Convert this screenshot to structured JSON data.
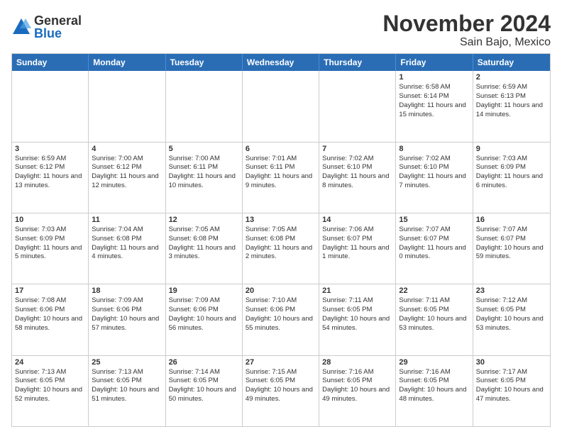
{
  "header": {
    "logo": {
      "general": "General",
      "blue": "Blue"
    },
    "title": "November 2024",
    "subtitle": "Sain Bajo, Mexico"
  },
  "calendar": {
    "days_of_week": [
      "Sunday",
      "Monday",
      "Tuesday",
      "Wednesday",
      "Thursday",
      "Friday",
      "Saturday"
    ],
    "weeks": [
      [
        {
          "day": "",
          "empty": true
        },
        {
          "day": "",
          "empty": true
        },
        {
          "day": "",
          "empty": true
        },
        {
          "day": "",
          "empty": true
        },
        {
          "day": "",
          "empty": true
        },
        {
          "day": "1",
          "sunrise": "Sunrise: 6:58 AM",
          "sunset": "Sunset: 6:14 PM",
          "daylight": "Daylight: 11 hours and 15 minutes."
        },
        {
          "day": "2",
          "sunrise": "Sunrise: 6:59 AM",
          "sunset": "Sunset: 6:13 PM",
          "daylight": "Daylight: 11 hours and 14 minutes."
        }
      ],
      [
        {
          "day": "3",
          "sunrise": "Sunrise: 6:59 AM",
          "sunset": "Sunset: 6:12 PM",
          "daylight": "Daylight: 11 hours and 13 minutes."
        },
        {
          "day": "4",
          "sunrise": "Sunrise: 7:00 AM",
          "sunset": "Sunset: 6:12 PM",
          "daylight": "Daylight: 11 hours and 12 minutes."
        },
        {
          "day": "5",
          "sunrise": "Sunrise: 7:00 AM",
          "sunset": "Sunset: 6:11 PM",
          "daylight": "Daylight: 11 hours and 10 minutes."
        },
        {
          "day": "6",
          "sunrise": "Sunrise: 7:01 AM",
          "sunset": "Sunset: 6:11 PM",
          "daylight": "Daylight: 11 hours and 9 minutes."
        },
        {
          "day": "7",
          "sunrise": "Sunrise: 7:02 AM",
          "sunset": "Sunset: 6:10 PM",
          "daylight": "Daylight: 11 hours and 8 minutes."
        },
        {
          "day": "8",
          "sunrise": "Sunrise: 7:02 AM",
          "sunset": "Sunset: 6:10 PM",
          "daylight": "Daylight: 11 hours and 7 minutes."
        },
        {
          "day": "9",
          "sunrise": "Sunrise: 7:03 AM",
          "sunset": "Sunset: 6:09 PM",
          "daylight": "Daylight: 11 hours and 6 minutes."
        }
      ],
      [
        {
          "day": "10",
          "sunrise": "Sunrise: 7:03 AM",
          "sunset": "Sunset: 6:09 PM",
          "daylight": "Daylight: 11 hours and 5 minutes."
        },
        {
          "day": "11",
          "sunrise": "Sunrise: 7:04 AM",
          "sunset": "Sunset: 6:08 PM",
          "daylight": "Daylight: 11 hours and 4 minutes."
        },
        {
          "day": "12",
          "sunrise": "Sunrise: 7:05 AM",
          "sunset": "Sunset: 6:08 PM",
          "daylight": "Daylight: 11 hours and 3 minutes."
        },
        {
          "day": "13",
          "sunrise": "Sunrise: 7:05 AM",
          "sunset": "Sunset: 6:08 PM",
          "daylight": "Daylight: 11 hours and 2 minutes."
        },
        {
          "day": "14",
          "sunrise": "Sunrise: 7:06 AM",
          "sunset": "Sunset: 6:07 PM",
          "daylight": "Daylight: 11 hours and 1 minute."
        },
        {
          "day": "15",
          "sunrise": "Sunrise: 7:07 AM",
          "sunset": "Sunset: 6:07 PM",
          "daylight": "Daylight: 11 hours and 0 minutes."
        },
        {
          "day": "16",
          "sunrise": "Sunrise: 7:07 AM",
          "sunset": "Sunset: 6:07 PM",
          "daylight": "Daylight: 10 hours and 59 minutes."
        }
      ],
      [
        {
          "day": "17",
          "sunrise": "Sunrise: 7:08 AM",
          "sunset": "Sunset: 6:06 PM",
          "daylight": "Daylight: 10 hours and 58 minutes."
        },
        {
          "day": "18",
          "sunrise": "Sunrise: 7:09 AM",
          "sunset": "Sunset: 6:06 PM",
          "daylight": "Daylight: 10 hours and 57 minutes."
        },
        {
          "day": "19",
          "sunrise": "Sunrise: 7:09 AM",
          "sunset": "Sunset: 6:06 PM",
          "daylight": "Daylight: 10 hours and 56 minutes."
        },
        {
          "day": "20",
          "sunrise": "Sunrise: 7:10 AM",
          "sunset": "Sunset: 6:06 PM",
          "daylight": "Daylight: 10 hours and 55 minutes."
        },
        {
          "day": "21",
          "sunrise": "Sunrise: 7:11 AM",
          "sunset": "Sunset: 6:05 PM",
          "daylight": "Daylight: 10 hours and 54 minutes."
        },
        {
          "day": "22",
          "sunrise": "Sunrise: 7:11 AM",
          "sunset": "Sunset: 6:05 PM",
          "daylight": "Daylight: 10 hours and 53 minutes."
        },
        {
          "day": "23",
          "sunrise": "Sunrise: 7:12 AM",
          "sunset": "Sunset: 6:05 PM",
          "daylight": "Daylight: 10 hours and 53 minutes."
        }
      ],
      [
        {
          "day": "24",
          "sunrise": "Sunrise: 7:13 AM",
          "sunset": "Sunset: 6:05 PM",
          "daylight": "Daylight: 10 hours and 52 minutes."
        },
        {
          "day": "25",
          "sunrise": "Sunrise: 7:13 AM",
          "sunset": "Sunset: 6:05 PM",
          "daylight": "Daylight: 10 hours and 51 minutes."
        },
        {
          "day": "26",
          "sunrise": "Sunrise: 7:14 AM",
          "sunset": "Sunset: 6:05 PM",
          "daylight": "Daylight: 10 hours and 50 minutes."
        },
        {
          "day": "27",
          "sunrise": "Sunrise: 7:15 AM",
          "sunset": "Sunset: 6:05 PM",
          "daylight": "Daylight: 10 hours and 49 minutes."
        },
        {
          "day": "28",
          "sunrise": "Sunrise: 7:16 AM",
          "sunset": "Sunset: 6:05 PM",
          "daylight": "Daylight: 10 hours and 49 minutes."
        },
        {
          "day": "29",
          "sunrise": "Sunrise: 7:16 AM",
          "sunset": "Sunset: 6:05 PM",
          "daylight": "Daylight: 10 hours and 48 minutes."
        },
        {
          "day": "30",
          "sunrise": "Sunrise: 7:17 AM",
          "sunset": "Sunset: 6:05 PM",
          "daylight": "Daylight: 10 hours and 47 minutes."
        }
      ]
    ]
  }
}
